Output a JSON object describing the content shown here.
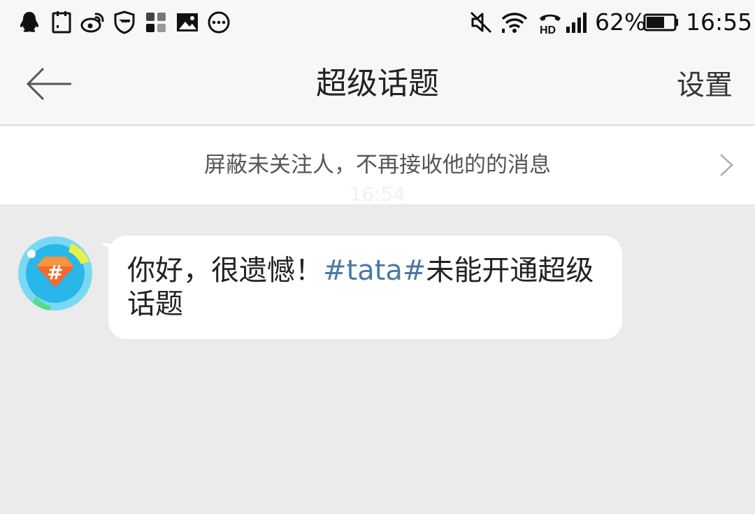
{
  "status_bar": {
    "icons": [
      "qq-icon",
      "clipboard-icon",
      "weibo-icon",
      "shield-icon",
      "apps-icon",
      "image-icon",
      "more-dots-icon",
      "mute-icon",
      "wifi-icon",
      "hd-call-icon",
      "signal-icon",
      "battery-icon"
    ],
    "battery": "62%",
    "time": "16:55"
  },
  "header": {
    "title": "超级话题",
    "settings_label": "设置"
  },
  "notice": {
    "text": "屏蔽未关注人，不再接收他的的消息"
  },
  "timestamp": "16:54",
  "message": {
    "prefix": "你好，很遗憾！",
    "topic": "#tata#",
    "suffix": "未能开通超级话题"
  },
  "colors": {
    "link": "#4a78a8",
    "background": "#ebebeb",
    "avatar_accent": "#f26a2e"
  }
}
